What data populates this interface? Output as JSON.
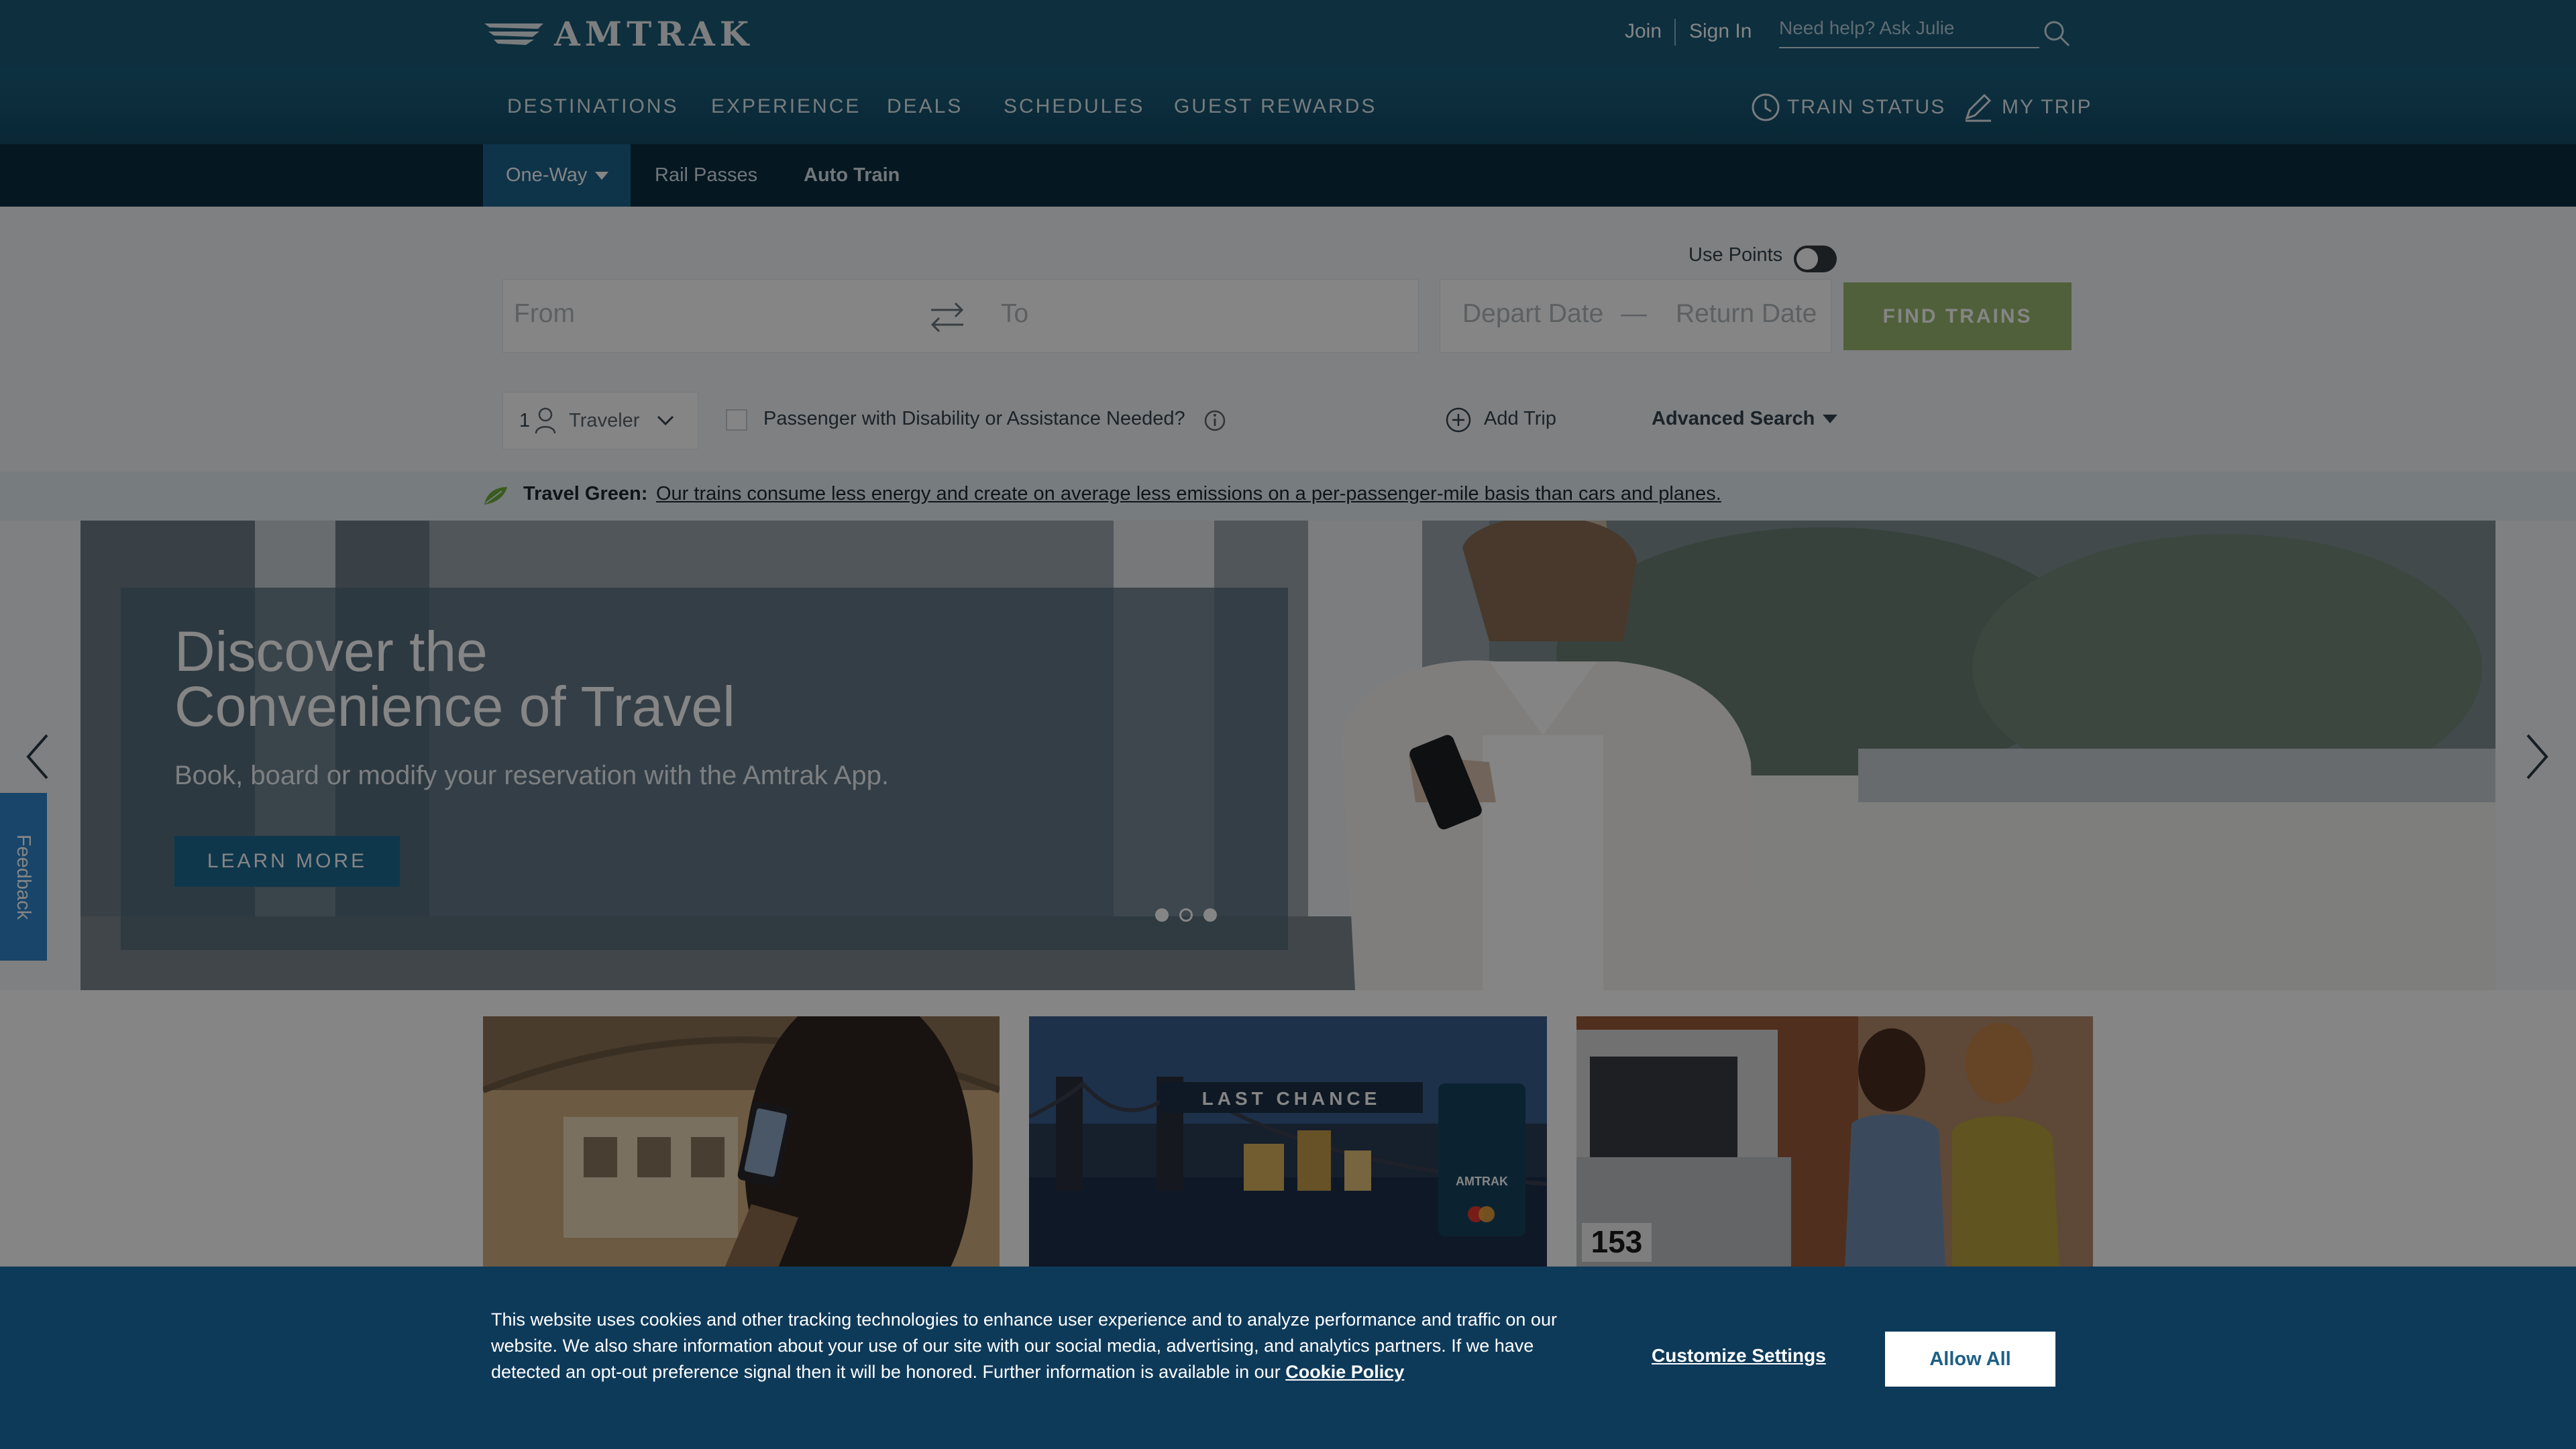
{
  "header": {
    "logo_text": "AMTRAK",
    "join": "Join",
    "sign_in": "Sign In",
    "search_placeholder": "Need help? Ask Julie"
  },
  "nav": {
    "items": [
      "DESTINATIONS",
      "EXPERIENCE",
      "DEALS",
      "SCHEDULES",
      "GUEST REWARDS"
    ],
    "train_status": "TRAIN STATUS",
    "my_trip": "MY TRIP"
  },
  "subnav": {
    "tabs": [
      "One-Way",
      "Rail Passes",
      "Auto Train"
    ]
  },
  "booking": {
    "use_points": "Use Points",
    "from_placeholder": "From",
    "to_placeholder": "To",
    "depart_placeholder": "Depart Date",
    "date_separator": "—",
    "return_placeholder": "Return Date",
    "find_trains": "FIND TRAINS",
    "traveler_count": "1",
    "traveler_label": "Traveler",
    "disability_label": "Passenger with Disability or Assistance Needed?",
    "add_trip": "Add Trip",
    "advanced_search": "Advanced Search"
  },
  "green_banner": {
    "label": "Travel Green:",
    "text": "Our trains consume less energy and create on average less emissions on a per-passenger-mile basis than cars and planes."
  },
  "hero": {
    "title_line1": "Discover the",
    "title_line2": "Convenience of Travel",
    "subtitle": "Book, board or modify your reservation with the Amtrak App.",
    "cta": "LEARN MORE"
  },
  "feedback": "Feedback",
  "cards": {
    "card2_badge": "LAST CHANCE",
    "card2_card_logo": "AMTRAK",
    "card3_car_number": "153"
  },
  "cookie": {
    "text": "This website uses cookies and other tracking technologies to enhance user experience and to analyze performance and traffic on our website. We also share information about your use of our site with our social media, advertising, and analytics partners. If we have detected an opt-out preference signal then it will be honored. Further information is available in our",
    "policy_link": "Cookie Policy",
    "customize": "Customize Settings",
    "allow_all": "Allow All"
  }
}
